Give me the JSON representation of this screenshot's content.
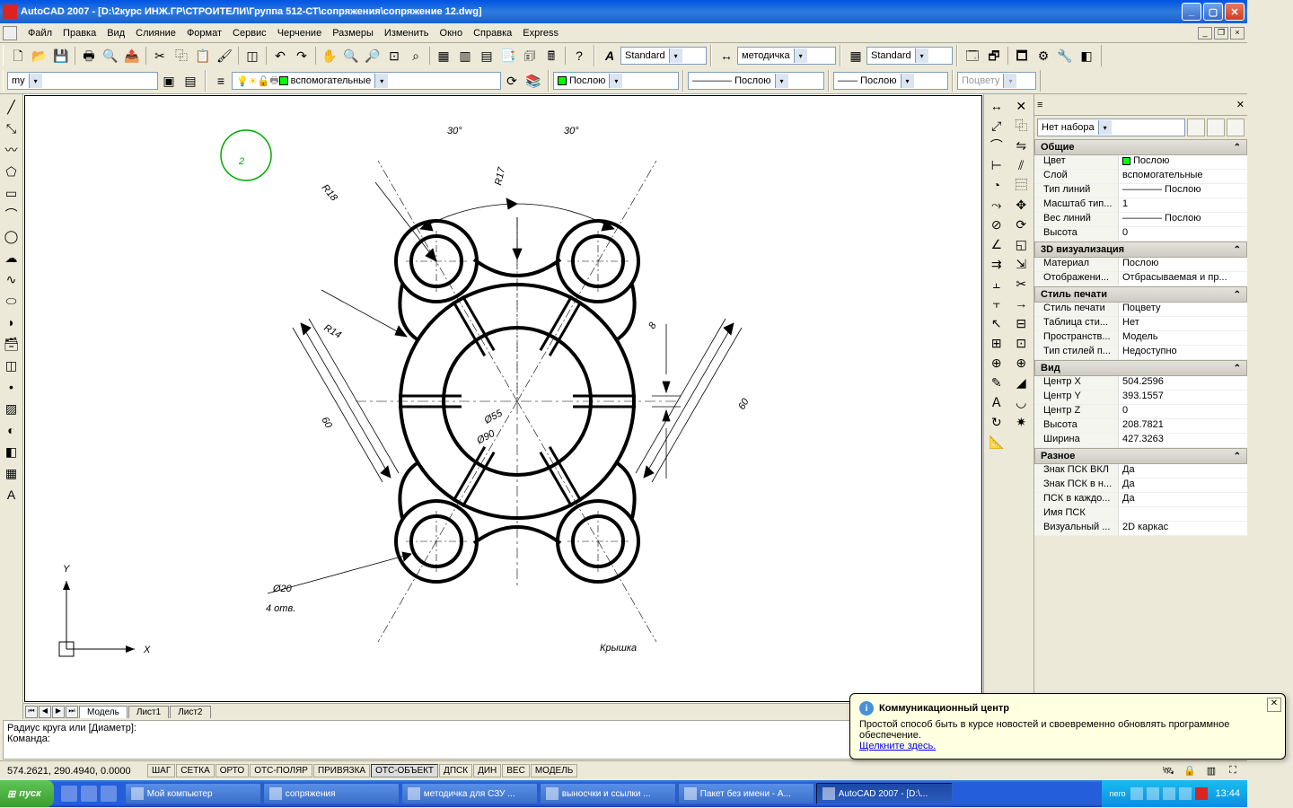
{
  "title": "AutoCAD 2007 - [D:\\2курс ИНЖ.ГР\\СТРОИТЕЛИ\\Группа 512-СТ\\сопряжения\\сопряжение 12.dwg]",
  "menu": [
    "Файл",
    "Правка",
    "Вид",
    "Слияние",
    "Формат",
    "Сервис",
    "Черчение",
    "Размеры",
    "Изменить",
    "Окно",
    "Справка",
    "Express"
  ],
  "row1": {
    "textstyle": "Standard",
    "dimstyle": "методичка",
    "tablestyle": "Standard"
  },
  "row2": {
    "layercombo_input": "my",
    "layer_current": "вспомогательные",
    "color": "Послою",
    "linetype": "Послою",
    "lineweight": "Послою",
    "plotstyle": "Поцвету"
  },
  "tabs": [
    "Модель",
    "Лист1",
    "Лист2"
  ],
  "cmd_lines": [
    "Радиус круга или [Диаметр]:",
    "Команда:"
  ],
  "status": {
    "coords": "574.2621, 290.4940, 0.0000",
    "buttons": [
      "ШАГ",
      "СЕТКА",
      "ОРТО",
      "ОТС-ПОЛЯР",
      "ПРИВЯЗКА",
      "ОТС-ОБЪЕКТ",
      "ДПСК",
      "ДИН",
      "ВЕС",
      "МОДЕЛЬ"
    ],
    "active": [
      false,
      false,
      false,
      false,
      false,
      true,
      false,
      false,
      false,
      false
    ]
  },
  "props": {
    "selector": "Нет набора",
    "sections": [
      {
        "title": "Общие",
        "rows": [
          {
            "k": "Цвет",
            "v": "Послою",
            "color": "#0f0"
          },
          {
            "k": "Слой",
            "v": "вспомогательные"
          },
          {
            "k": "Тип линий",
            "v": "———— Послою"
          },
          {
            "k": "Масштаб тип...",
            "v": "1"
          },
          {
            "k": "Вес линий",
            "v": "———— Послою"
          },
          {
            "k": "Высота",
            "v": "0"
          }
        ]
      },
      {
        "title": "3D визуализация",
        "rows": [
          {
            "k": "Материал",
            "v": "Послою"
          },
          {
            "k": "Отображени...",
            "v": "Отбрасываемая и пр..."
          }
        ]
      },
      {
        "title": "Стиль печати",
        "rows": [
          {
            "k": "Стиль печати",
            "v": "Поцвету"
          },
          {
            "k": "Таблица сти...",
            "v": "Нет"
          },
          {
            "k": "Пространств...",
            "v": "Модель"
          },
          {
            "k": "Тип стилей п...",
            "v": "Недоступно"
          }
        ]
      },
      {
        "title": "Вид",
        "rows": [
          {
            "k": "Центр X",
            "v": "504.2596"
          },
          {
            "k": "Центр Y",
            "v": "393.1557"
          },
          {
            "k": "Центр Z",
            "v": "0"
          },
          {
            "k": "Высота",
            "v": "208.7821"
          },
          {
            "k": "Ширина",
            "v": "427.3263"
          }
        ]
      },
      {
        "title": "Разное",
        "rows": [
          {
            "k": "Знак ПСК ВКЛ",
            "v": "Да"
          },
          {
            "k": "Знак ПСК в н...",
            "v": "Да"
          },
          {
            "k": "ПСК в каждо...",
            "v": "Да"
          },
          {
            "k": "Имя ПСК",
            "v": ""
          },
          {
            "k": "Визуальный ...",
            "v": "2D каркас"
          }
        ]
      }
    ]
  },
  "drawing": {
    "stamp": "2",
    "title": "Крышка",
    "dims": {
      "r18": "R18",
      "r17": "R17",
      "r14": "R14",
      "a30l": "30°",
      "a30r": "30°",
      "d60l": "60",
      "d60r": "60",
      "d8": "8",
      "d55": "Ø55",
      "d90": "Ø90",
      "d20": "Ø20",
      "holes": "4 отв."
    }
  },
  "comm": {
    "title": "Коммуникационный центр",
    "body": "Простой способ быть в курсе новостей и своевременно обновлять программное обеспечение.",
    "link": "Щелкните здесь."
  },
  "taskbar": {
    "start": "пуск",
    "tasks": [
      "Мой компьютер",
      "сопряжения",
      "методичка для СЗУ ...",
      "выносчки и ссылки ...",
      "Пакет без имени - A...",
      "AutoCAD 2007 - [D:\\..."
    ],
    "active_task": 5,
    "time": "13:44"
  }
}
